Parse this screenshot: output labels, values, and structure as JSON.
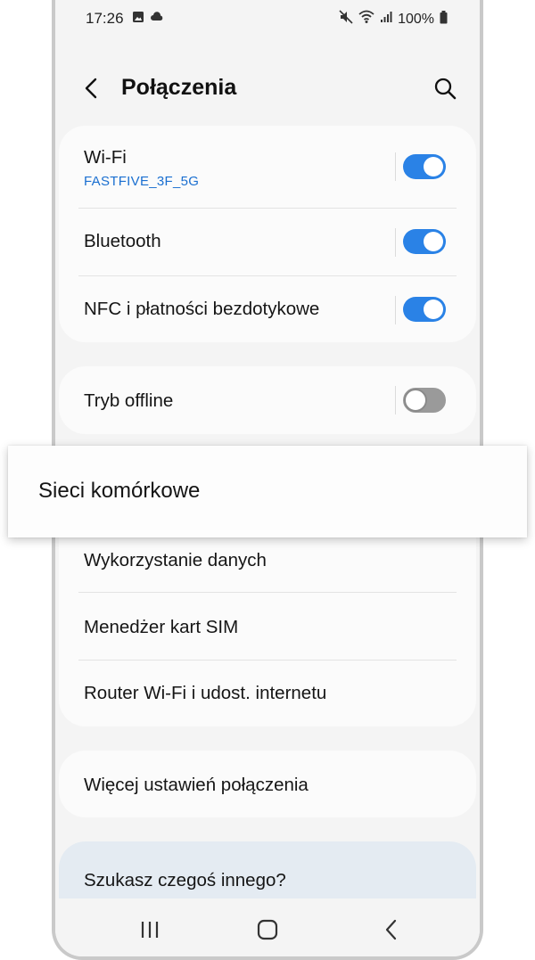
{
  "status_bar": {
    "time": "17:26",
    "battery": "100%",
    "icons": [
      "gallery-icon",
      "cloud-icon",
      "mute-icon",
      "wifi-icon",
      "signal-icon",
      "battery-icon"
    ]
  },
  "header": {
    "title": "Połączenia",
    "icons": [
      "back-arrow-icon",
      "search-icon"
    ]
  },
  "groups": {
    "connectivity": {
      "wifi": {
        "label": "Wi-Fi",
        "network": "FASTFIVE_3F_5G",
        "enabled": true
      },
      "bluetooth": {
        "label": "Bluetooth",
        "enabled": true
      },
      "nfc": {
        "label": "NFC i płatności bezdotykowe",
        "enabled": true
      }
    },
    "offline": {
      "label": "Tryb offline",
      "enabled": false
    },
    "mobile": {
      "highlighted": "Sieci komórkowe",
      "items": [
        "Wykorzystanie danych",
        "Menedżer kart SIM",
        "Router Wi-Fi i udost. internetu"
      ]
    },
    "more": {
      "label": "Więcej ustawień połączenia"
    },
    "suggest": {
      "label": "Szukasz czegoś innego?"
    }
  },
  "navigation": {
    "icons": [
      "recent-apps-icon",
      "home-icon",
      "back-icon"
    ]
  },
  "colors": {
    "accent": "#2a82e6",
    "link": "#1a6fd0",
    "toggle_off": "#9a9a9a",
    "background": "#f4f4f4",
    "card": "#fbfbfb",
    "suggest_card": "#e4ebf2"
  }
}
